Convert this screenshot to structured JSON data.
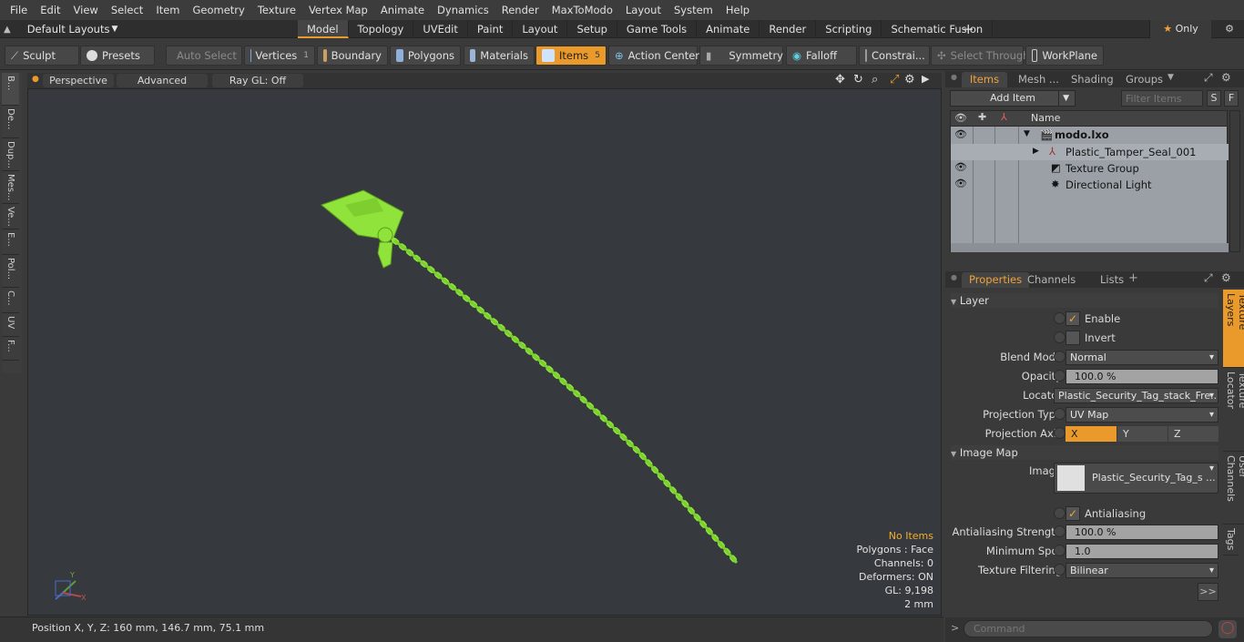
{
  "menu": [
    "File",
    "Edit",
    "View",
    "Select",
    "Item",
    "Geometry",
    "Texture",
    "Vertex Map",
    "Animate",
    "Dynamics",
    "Render",
    "MaxToModo",
    "Layout",
    "System",
    "Help"
  ],
  "layout_select": "Default Layouts",
  "tabs": [
    {
      "label": "Model",
      "active": true
    },
    {
      "label": "Topology"
    },
    {
      "label": "UVEdit"
    },
    {
      "label": "Paint"
    },
    {
      "label": "Layout"
    },
    {
      "label": "Setup"
    },
    {
      "label": "Game Tools"
    },
    {
      "label": "Animate"
    },
    {
      "label": "Render"
    },
    {
      "label": "Scripting"
    },
    {
      "label": "Schematic Fusion"
    }
  ],
  "only_label": "Only",
  "toolbar": {
    "sculpt": "Sculpt",
    "presets": "Presets",
    "auto_select": "Auto Select",
    "vertices": "Vertices",
    "vertices_count": "1",
    "boundary": "Boundary",
    "polygons": "Polygons",
    "materials": "Materials",
    "items": "Items",
    "items_count": "5",
    "action_center": "Action Center",
    "symmetry": "Symmetry",
    "falloff": "Falloff",
    "constraints": "Constrai...",
    "select_through": "Select Through",
    "workplane": "WorkPlane"
  },
  "left_tabs": [
    "B...",
    "De...",
    "Dup...",
    "Mes...",
    "Ve...",
    "E...",
    "Pol...",
    "C...",
    "UV",
    "F..."
  ],
  "viewport": {
    "perspective": "Perspective",
    "advanced": "Advanced",
    "raygl": "Ray GL: Off",
    "info": {
      "no_items": "No Items",
      "polygons": "Polygons : Face",
      "channels": "Channels: 0",
      "deformers": "Deformers: ON",
      "gl": "GL: 9,198",
      "scale": "2 mm"
    },
    "axis_x": "X",
    "axis_y": "Y"
  },
  "status": "Position X, Y, Z:   160 mm, 146.7 mm, 75.1 mm",
  "items_panel": {
    "tabs": [
      "Items",
      "Mesh ...",
      "Shading",
      "Groups"
    ],
    "add_item": "Add Item",
    "filter_placeholder": "Filter Items",
    "s": "S",
    "f": "F",
    "name_col": "Name",
    "rows": [
      {
        "name": "modo.lxo",
        "eye": true
      },
      {
        "name": "Plastic_Tamper_Seal_001",
        "eye": false
      },
      {
        "name": "Texture Group",
        "eye": true
      },
      {
        "name": "Directional Light",
        "eye": true
      }
    ]
  },
  "props_panel": {
    "tabs": [
      "Properties",
      "Channels",
      "Lists"
    ],
    "layer_section": "Layer",
    "enable": "Enable",
    "invert": "Invert",
    "blend_mode_label": "Blend Mode",
    "blend_mode": "Normal",
    "opacity_label": "Opacity",
    "opacity": "100.0 %",
    "locator_label": "Locator",
    "locator": "Plastic_Security_Tag_stack_Fre...",
    "proj_type_label": "Projection Type",
    "proj_type": "UV Map",
    "proj_axis_label": "Projection Axis",
    "axis": [
      "X",
      "Y",
      "Z"
    ],
    "image_map_section": "Image Map",
    "image_label": "Image",
    "image": "Plastic_Security_Tag_s ...",
    "antialiasing": "Antialiasing",
    "aa_strength_label": "Antialiasing Strength",
    "aa_strength": "100.0 %",
    "min_spot_label": "Minimum Spot",
    "min_spot": "1.0",
    "tex_filter_label": "Texture Filtering",
    "tex_filter": "Bilinear",
    "more": ">>",
    "side_tabs": [
      "Texture Layers",
      "Texture Locator",
      "User Channels",
      "Tags"
    ]
  },
  "command_placeholder": "Command",
  "colors": {
    "accent": "#e99a2a",
    "mesh": "#8fe33a"
  }
}
